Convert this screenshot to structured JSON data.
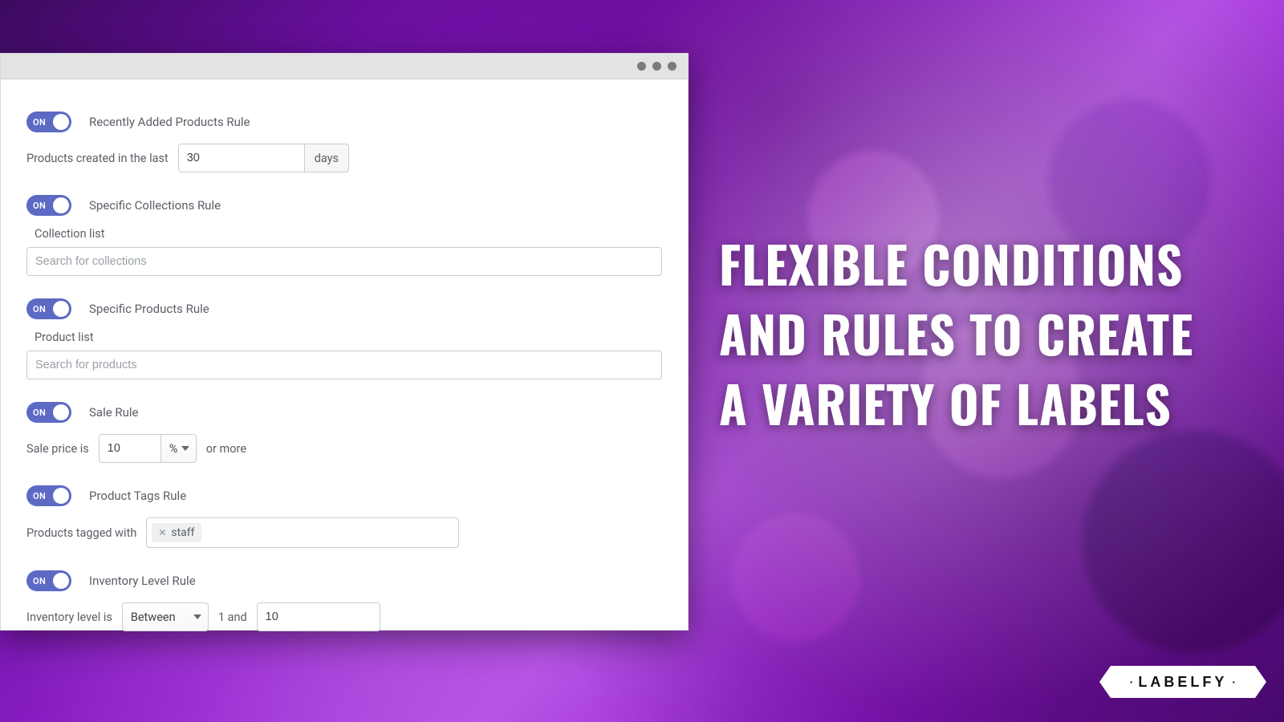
{
  "hero": {
    "text": "Flexible conditions and rules to create a variety of labels"
  },
  "logo": {
    "text": "LABELFY"
  },
  "toggle_label": "ON",
  "rules": {
    "recent": {
      "title": "Recently Added Products Rule",
      "prefix": "Products created in the last",
      "value": "30",
      "unit": "days"
    },
    "collections": {
      "title": "Specific Collections Rule",
      "list_label": "Collection list",
      "placeholder": "Search for collections"
    },
    "products": {
      "title": "Specific Products Rule",
      "list_label": "Product list",
      "placeholder": "Search for products"
    },
    "sale": {
      "title": "Sale Rule",
      "prefix": "Sale price is",
      "value": "10",
      "unit": "%",
      "suffix": "or more"
    },
    "tags": {
      "title": "Product Tags Rule",
      "prefix": "Products tagged with",
      "tag": "staff"
    },
    "inventory": {
      "title": "Inventory Level Rule",
      "prefix": "Inventory level is",
      "operator": "Between",
      "mid": "1 and",
      "value": "10"
    }
  }
}
